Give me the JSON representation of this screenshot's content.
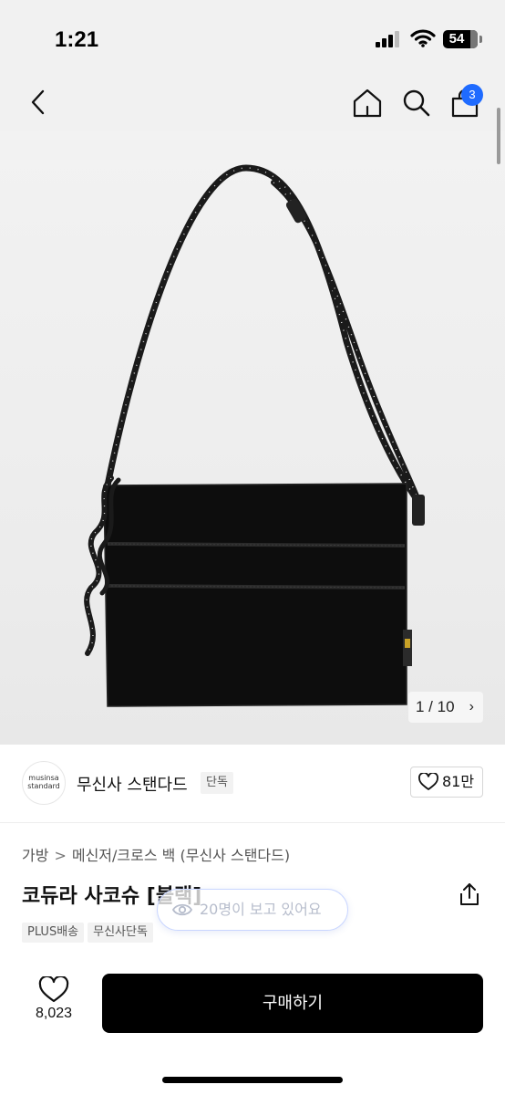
{
  "status_bar": {
    "time": "1:21",
    "battery": "54",
    "icons": [
      "signal-icon",
      "wifi-icon",
      "battery-icon"
    ]
  },
  "nav": {
    "icons": [
      "back-icon",
      "home-icon",
      "search-icon",
      "cart-icon"
    ],
    "cart_count": "3"
  },
  "gallery": {
    "pager_text": "1 / 10",
    "pager_chevron": "›"
  },
  "brand": {
    "logo_line1": "musinsa",
    "logo_line2": "standard",
    "name": "무신사 스탠다드",
    "badge": "단독",
    "like_count": "81만"
  },
  "product": {
    "breadcrumb": [
      "가방",
      "메신저/크로스 백",
      "(무신사 스탠다드)"
    ],
    "breadcrumb_sep": ">",
    "title": "코듀라 사코슈 [블랙]",
    "viewers_text": "20명이 보고 있어요",
    "tags": [
      "PLUS배송",
      "무신사단독"
    ]
  },
  "bottom": {
    "wish_count": "8,023",
    "buy_label": "구매하기"
  },
  "colors": {
    "accent_badge": "#1f6bff",
    "buy_button": "#000000",
    "page_bg": "#ffffff",
    "image_bg": "#eeeeee"
  }
}
